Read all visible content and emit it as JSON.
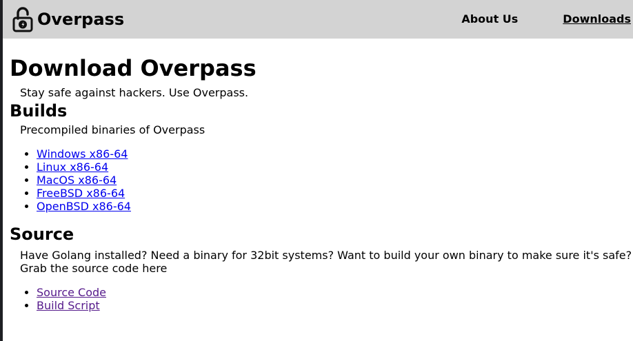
{
  "navbar": {
    "brand": "Overpass",
    "links": [
      {
        "label": "About Us",
        "active": false
      },
      {
        "label": "Downloads",
        "active": true
      }
    ]
  },
  "page": {
    "title": "Download Overpass",
    "tagline": "Stay safe against hackers. Use Overpass."
  },
  "builds": {
    "heading": "Builds",
    "description": "Precompiled binaries of Overpass",
    "items": [
      "Windows x86-64",
      "Linux x86-64",
      "MacOS x86-64",
      "FreeBSD x86-64",
      "OpenBSD x86-64"
    ]
  },
  "source": {
    "heading": "Source",
    "description_line1": "Have Golang installed? Need a binary for 32bit systems? Want to build your own binary to make sure it's safe?",
    "description_line2": "Grab the source code here",
    "items": [
      "Source Code",
      "Build Script"
    ]
  },
  "colors": {
    "navbar_bg": "#d3d3d3",
    "link": "#0000ee",
    "visited_link": "#551a8b"
  },
  "icons": {
    "brand": "padlock-icon"
  }
}
